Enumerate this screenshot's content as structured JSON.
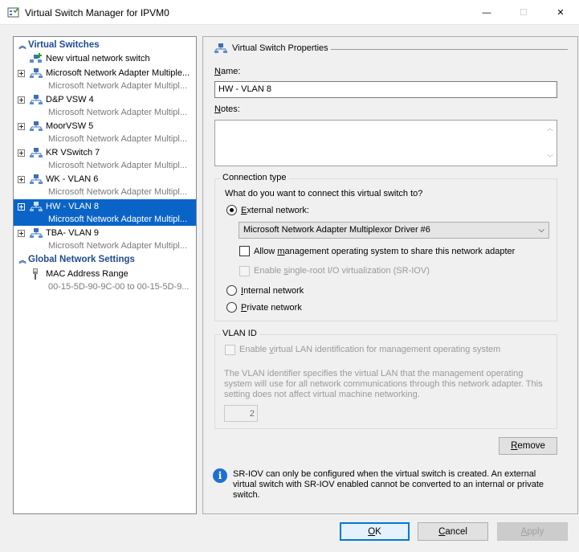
{
  "window": {
    "title": "Virtual Switch Manager for IPVM0",
    "minimize_glyph": "—",
    "maximize_glyph": "☐",
    "close_glyph": "✕"
  },
  "tree": {
    "virtual_switches_header": "Virtual Switches",
    "new_switch": "New virtual network switch",
    "switches": [
      {
        "name": "Microsoft Network Adapter Multiple...",
        "adapter": "Microsoft Network Adapter Multipl..."
      },
      {
        "name": "D&P VSW 4",
        "adapter": "Microsoft Network Adapter Multipl..."
      },
      {
        "name": "MoorVSW 5",
        "adapter": "Microsoft Network Adapter Multipl..."
      },
      {
        "name": "KR VSwitch 7",
        "adapter": "Microsoft Network Adapter Multipl..."
      },
      {
        "name": "WK - VLAN 6",
        "adapter": "Microsoft Network Adapter Multipl..."
      },
      {
        "name": "HW - VLAN 8",
        "adapter": "Microsoft Network Adapter Multipl..."
      },
      {
        "name": "TBA- VLAN 9",
        "adapter": "Microsoft Network Adapter Multipl..."
      }
    ],
    "global_header": "Global Network Settings",
    "mac": {
      "name": "MAC Address Range",
      "value": "00-15-5D-90-9C-00 to 00-15-5D-9..."
    }
  },
  "props": {
    "title": "Virtual Switch Properties",
    "name_label_u": "N",
    "name_label_rest": "ame:",
    "name_value": "HW - VLAN 8",
    "notes_label_u": "N",
    "notes_label_rest": "otes:",
    "connection_type": "Connection type",
    "question": "What do you want to connect this virtual switch to?",
    "external_u": "E",
    "external_rest": "xternal network:",
    "adapter_selected": "Microsoft Network Adapter Multiplexor Driver #6",
    "allow_pre": "Allow ",
    "allow_u": "m",
    "allow_rest": "anagement operating system to share this network adapter",
    "sriov_pre": "Enable ",
    "sriov_u": "s",
    "sriov_rest": "ingle-root I/O virtualization (SR-IOV)",
    "internal_u": "I",
    "internal_rest": "nternal network",
    "private_u": "P",
    "private_rest": "rivate network",
    "vlan_header": "VLAN ID",
    "vlan_enable_pre": "Enable ",
    "vlan_enable_u": "v",
    "vlan_enable_rest": "irtual LAN identification for management operating system",
    "vlan_desc": "The VLAN identifier specifies the virtual LAN that the management operating system will use for all network communications through this network adapter. This setting does not affect virtual machine networking.",
    "vlan_value": "2",
    "remove_u": "R",
    "remove_rest": "emove",
    "info_text": "SR-IOV can only be configured when the virtual switch is created. An external virtual switch with SR-IOV enabled cannot be converted to an internal or private switch."
  },
  "footer": {
    "ok_u": "O",
    "ok_rest": "K",
    "cancel_u": "C",
    "cancel_rest": "ancel",
    "apply_u": "A",
    "apply_rest": "pply"
  }
}
